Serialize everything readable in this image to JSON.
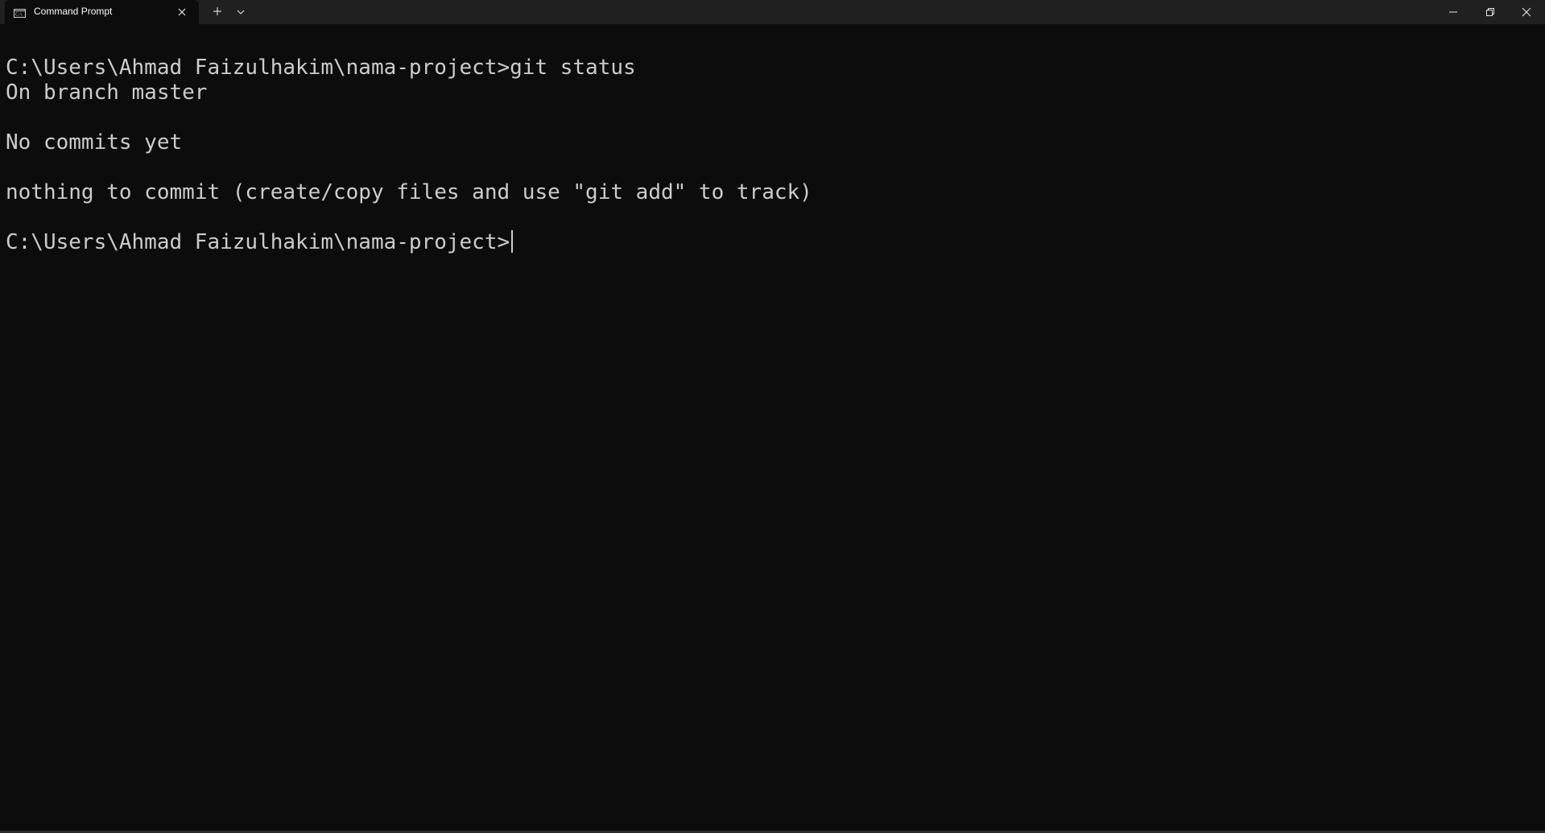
{
  "tab": {
    "title": "Command Prompt",
    "icon": "terminal-icon"
  },
  "titlebar": {
    "new_tab_icon": "plus-icon",
    "dropdown_icon": "chevron-down-icon",
    "minimize_icon": "minimize-icon",
    "maximize_icon": "restore-icon",
    "close_icon": "close-icon"
  },
  "terminal": {
    "lines": [
      "C:\\Users\\Ahmad Faizulhakim\\nama-project>git status",
      "On branch master",
      "",
      "No commits yet",
      "",
      "nothing to commit (create/copy files and use \"git add\" to track)",
      "",
      "C:\\Users\\Ahmad Faizulhakim\\nama-project>"
    ]
  },
  "colors": {
    "background": "#0c0c0c",
    "titlebar": "#202020",
    "text": "#cccccc"
  }
}
